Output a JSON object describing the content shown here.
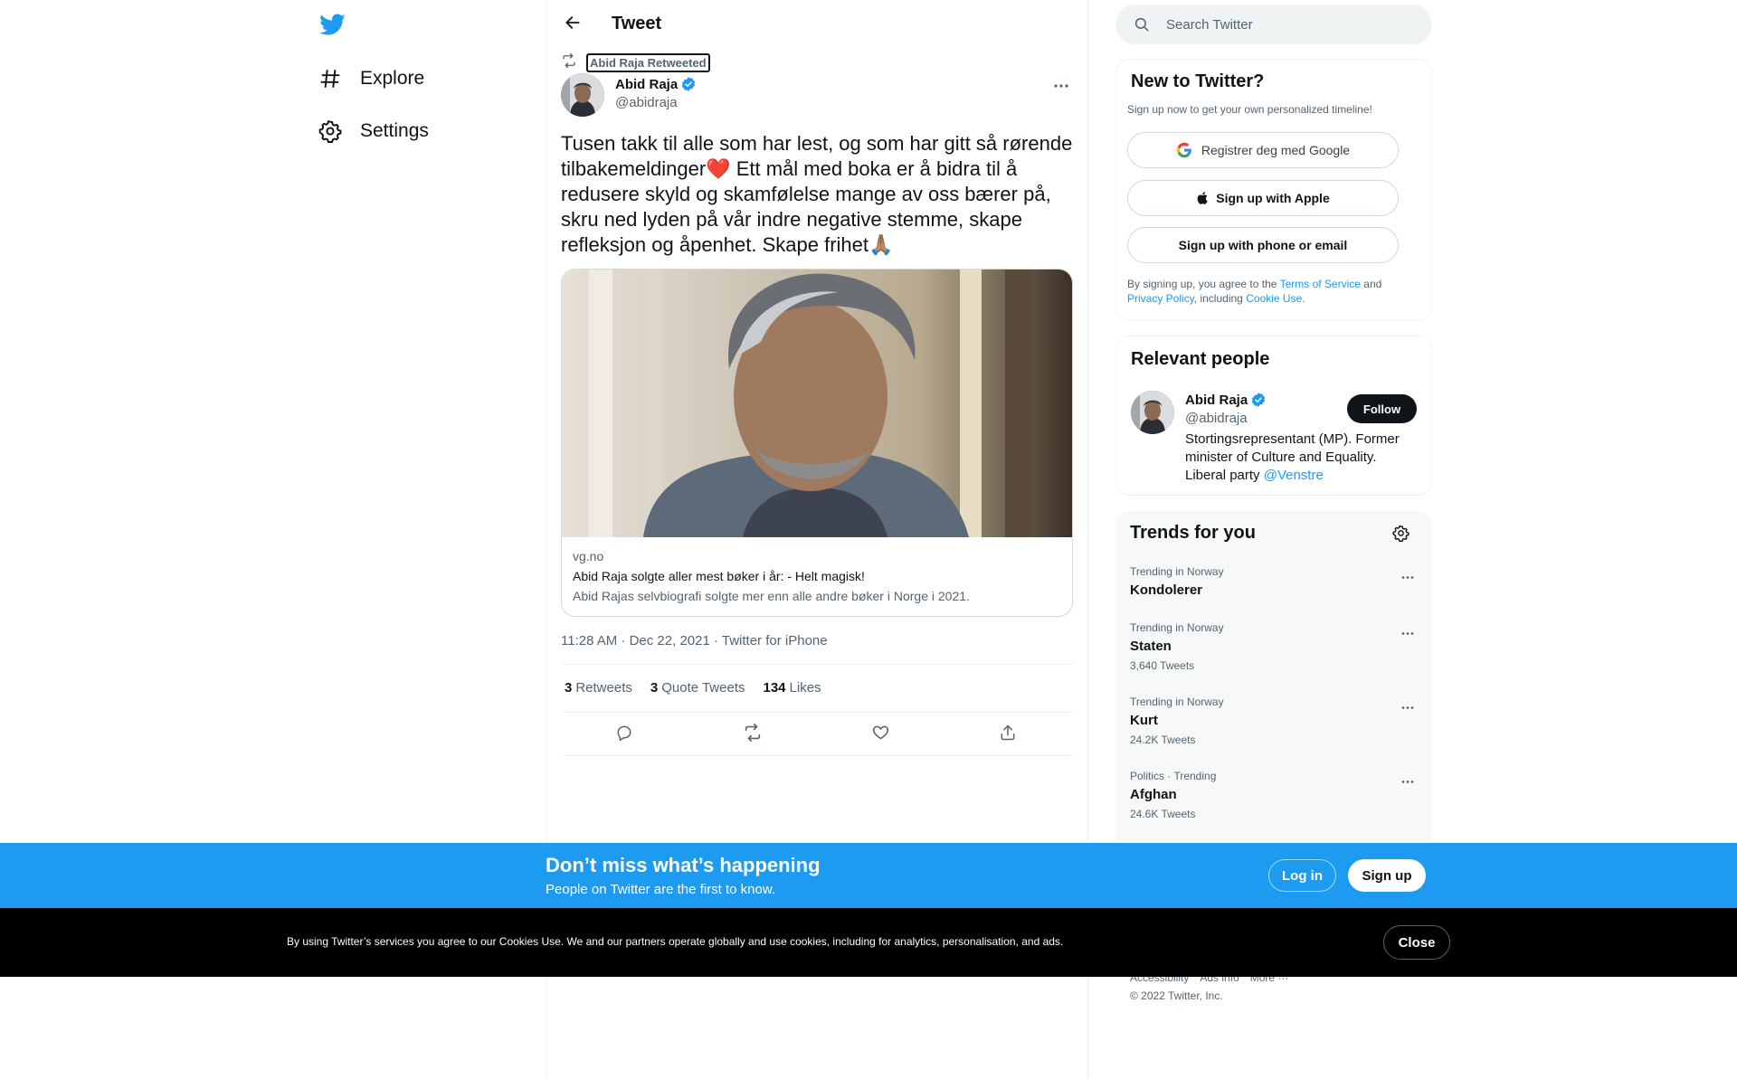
{
  "nav": {
    "explore_label": "Explore",
    "settings_label": "Settings"
  },
  "header": {
    "title": "Tweet"
  },
  "tweet": {
    "retweeted_by": "Abid Raja Retweeted",
    "author_name": "Abid Raja",
    "author_handle": "@abidraja",
    "text": "Tusen takk til alle som har lest, og som har gitt så rørende tilbakemeldinger❤️ Ett mål med boka er å bidra til å redusere skyld og skamfølelse mange av oss bærer på, skru ned lyden på vår indre negative stemme, skape refleksjon og åpenhet. Skape frihet🙏🏽",
    "card": {
      "domain": "vg.no",
      "title": "Abid Raja solgte aller mest bøker i år: - Helt magisk!",
      "description": "Abid Rajas selvbiografi solgte mer enn alle andre bøker i Norge i 2021."
    },
    "timestamp": "11:28 AM · Dec 22, 2021 · Twitter for iPhone",
    "stats": {
      "retweets_count": "3",
      "retweets_label": "Retweets",
      "quotes_count": "3",
      "quotes_label": "Quote Tweets",
      "likes_count": "134",
      "likes_label": "Likes"
    }
  },
  "search": {
    "placeholder": "Search Twitter"
  },
  "new_to_twitter": {
    "title": "New to Twitter?",
    "subtitle": "Sign up now to get your own personalized timeline!",
    "google_label": "Registrer deg med Google",
    "apple_label": "Sign up with Apple",
    "phone_label": "Sign up with phone or email",
    "legal_prefix": "By signing up, you agree to the",
    "terms_link": "Terms of Service",
    "and": "and",
    "privacy_link": "Privacy Policy",
    "including": ", including",
    "cookie_link": "Cookie Use."
  },
  "relevant_people": {
    "title": "Relevant people",
    "name": "Abid Raja",
    "handle": "@abidraja",
    "follow_label": "Follow",
    "bio": "Stortingsrepresentant (MP). Former minister of Culture and Equality. Liberal party",
    "bio_link": "@Venstre"
  },
  "trends": {
    "title": "Trends for you",
    "items": [
      {
        "meta": "Trending in Norway",
        "name": "Kondolerer",
        "count": ""
      },
      {
        "meta": "Trending in Norway",
        "name": "Staten",
        "count": "3,640 Tweets"
      },
      {
        "meta": "Trending in Norway",
        "name": "Kurt",
        "count": "24.2K Tweets"
      },
      {
        "meta": "Politics · Trending",
        "name": "Afghan",
        "count": "24.6K Tweets"
      }
    ]
  },
  "footer": {
    "accessibility": "Accessibility",
    "ads_info": "Ads info",
    "more": "More ···",
    "copyright": "© 2022 Twitter, Inc."
  },
  "signup_bar": {
    "title": "Don’t miss what’s happening",
    "subtitle": "People on Twitter are the first to know.",
    "login_label": "Log in",
    "signup_label": "Sign up"
  },
  "cookie_bar": {
    "text": "By using Twitter’s services you agree to our Cookies Use. We and our partners operate globally and use cookies, including for analytics, personalisation, and ads.",
    "close_label": "Close"
  },
  "colors": {
    "brand": "#1d9bf0",
    "text": "#0f1419",
    "secondary": "#536471"
  }
}
